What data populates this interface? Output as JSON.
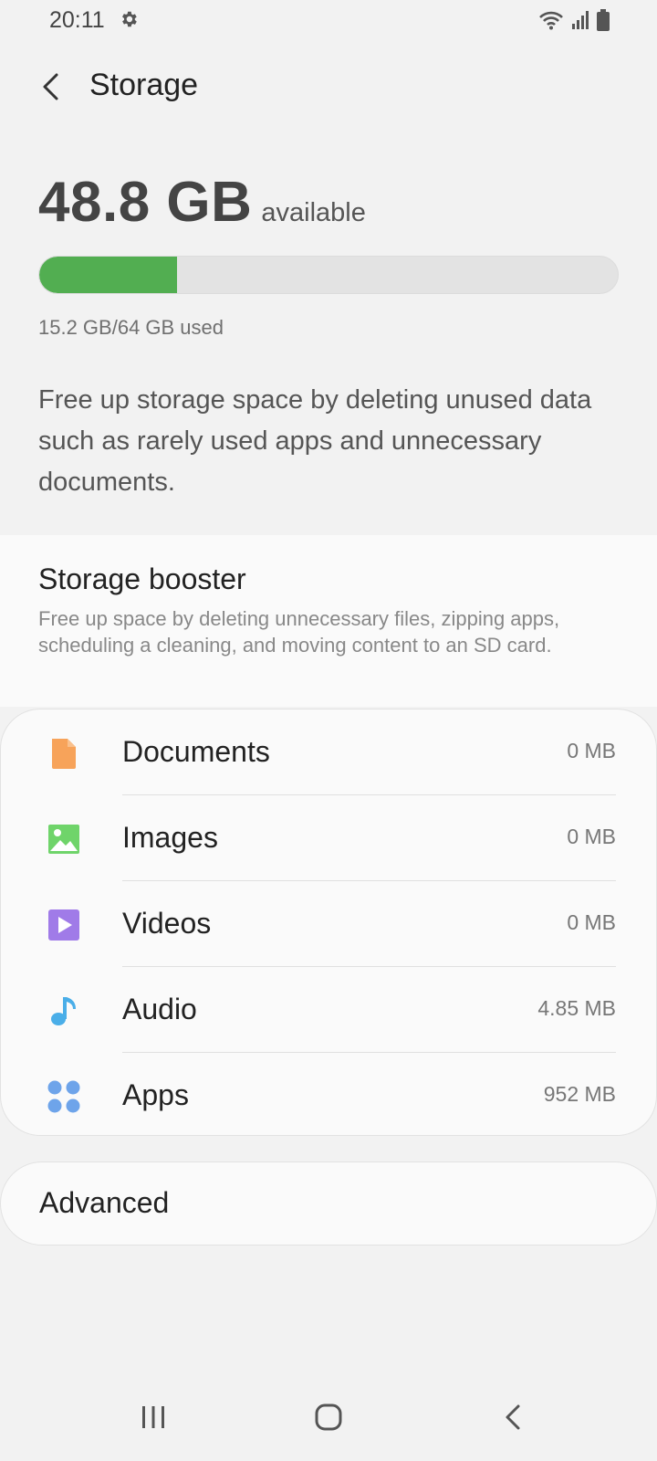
{
  "status_bar": {
    "time": "20:11",
    "icons": [
      "gear-icon",
      "wifi-icon",
      "signal-icon",
      "battery-icon"
    ]
  },
  "header": {
    "title": "Storage",
    "back_icon": "chevron-left-icon"
  },
  "summary": {
    "available_amount": "48.8 GB",
    "available_word": "available",
    "used_text": "15.2 GB/64 GB used",
    "used_fraction": 0.2375,
    "bar_color": "#52ae51",
    "description": "Free up storage space by deleting unused data such as rarely used apps and unnecessary documents."
  },
  "booster": {
    "title": "Storage booster",
    "description": "Free up space by deleting unnecessary files, zipping apps, scheduling a cleaning, and moving content to an SD card."
  },
  "categories": [
    {
      "label": "Documents",
      "size": "0 MB",
      "icon": "document-icon",
      "color": "#f7a35a"
    },
    {
      "label": "Images",
      "size": "0 MB",
      "icon": "image-icon",
      "color": "#6fd46a"
    },
    {
      "label": "Videos",
      "size": "0 MB",
      "icon": "video-icon",
      "color": "#a07be8"
    },
    {
      "label": "Audio",
      "size": "4.85 MB",
      "icon": "music-note-icon",
      "color": "#4aaee8"
    },
    {
      "label": "Apps",
      "size": "952 MB",
      "icon": "apps-grid-icon",
      "color": "#6ea4ea"
    }
  ],
  "advanced": {
    "label": "Advanced"
  },
  "nav_bar": {
    "icons": [
      "recents-icon",
      "home-icon",
      "back-icon"
    ]
  }
}
